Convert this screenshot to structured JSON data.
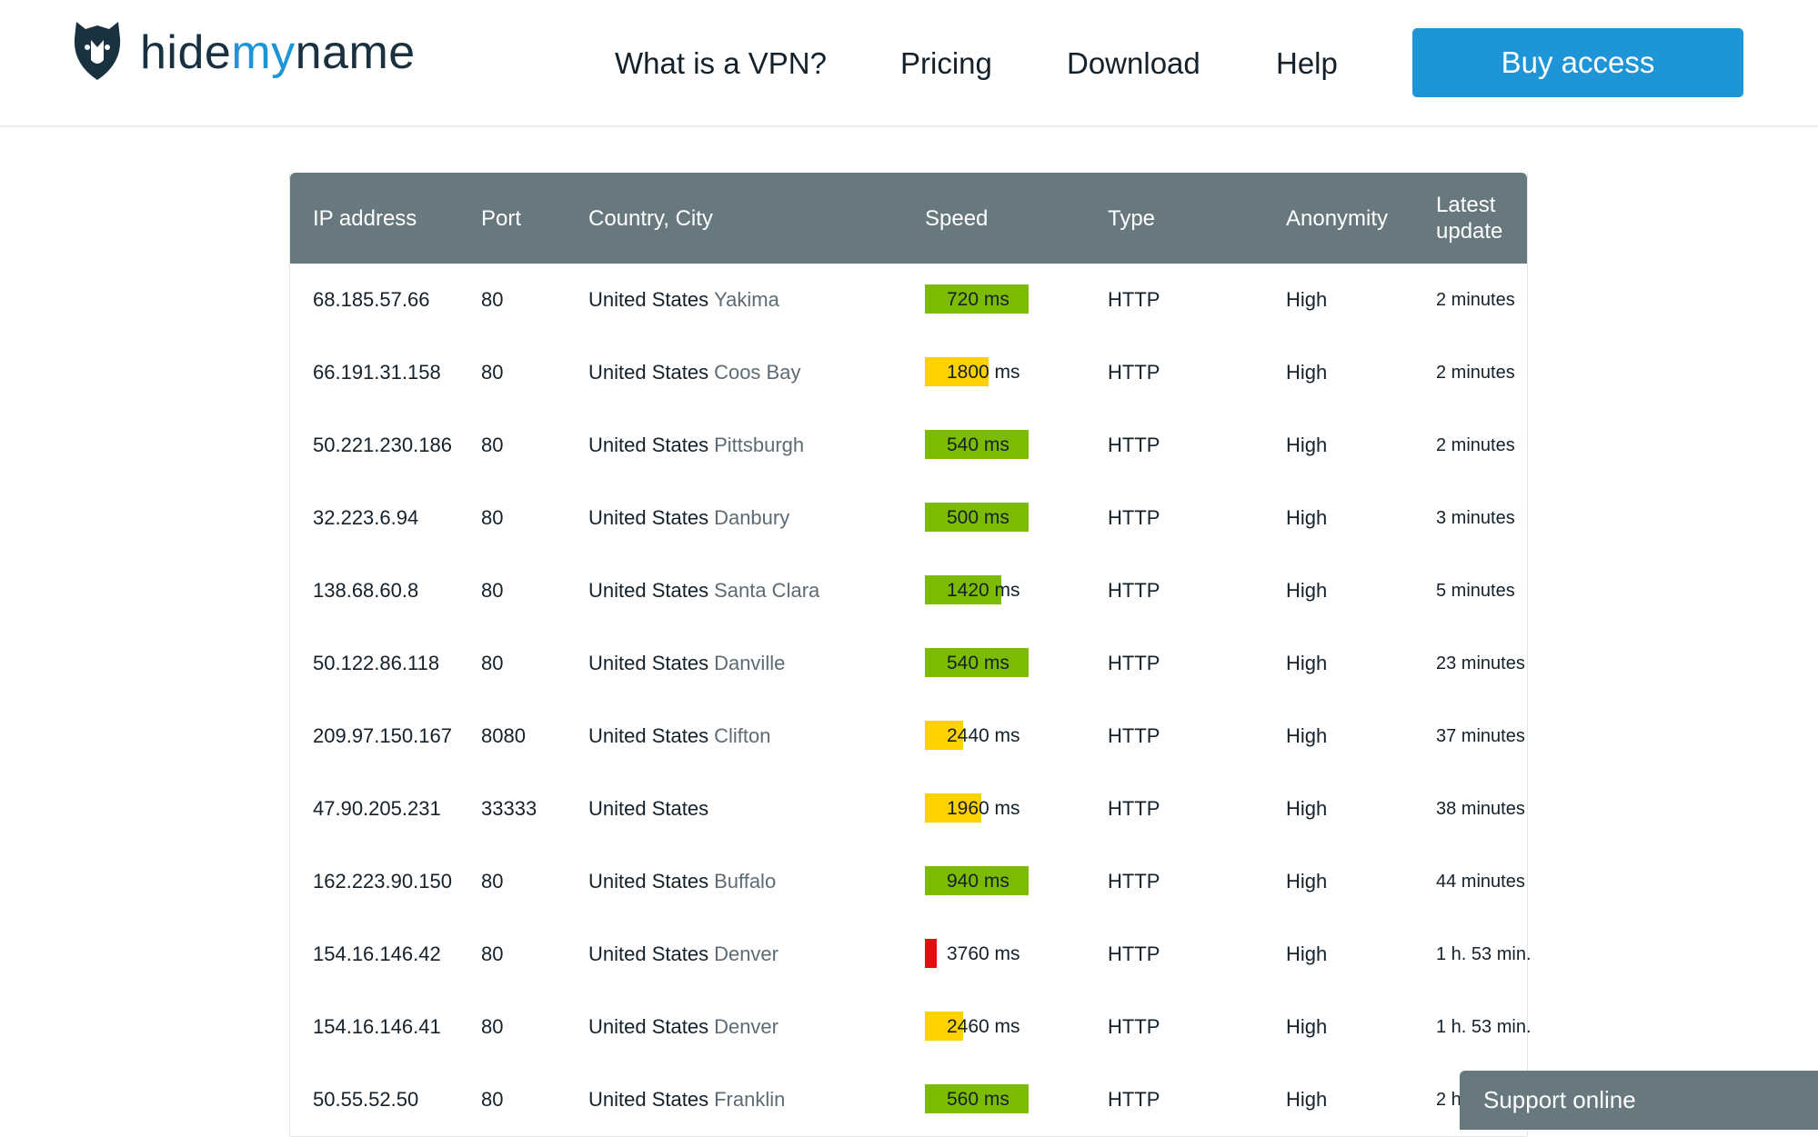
{
  "brand": {
    "name_part1": "hide",
    "name_part2": "my",
    "name_part3": "name",
    "logo_icon": "shield-fox-icon"
  },
  "nav": {
    "items": [
      "What is a VPN?",
      "Pricing",
      "Download",
      "Help"
    ],
    "buy_label": "Buy access"
  },
  "colors": {
    "accent": "#1e95d6",
    "header_bg": "#68787f",
    "speed_fast": "#7cbb00",
    "speed_medium": "#ffd100",
    "speed_slow": "#e01010"
  },
  "table": {
    "headers": {
      "ip": "IP address",
      "port": "Port",
      "country": "Country, City",
      "speed": "Speed",
      "type": "Type",
      "anonymity": "Anonymity",
      "update_line1": "Latest",
      "update_line2": "update"
    },
    "rows": [
      {
        "ip": "68.185.57.66",
        "port": "80",
        "country": "United States",
        "city": "Yakima",
        "speed": "720 ms",
        "speed_level": "fast",
        "type": "HTTP",
        "anonymity": "High",
        "update": "2 minutes"
      },
      {
        "ip": "66.191.31.158",
        "port": "80",
        "country": "United States",
        "city": "Coos Bay",
        "speed": "1800 ms",
        "speed_level": "medium",
        "type": "HTTP",
        "anonymity": "High",
        "update": "2 minutes"
      },
      {
        "ip": "50.221.230.186",
        "port": "80",
        "country": "United States",
        "city": "Pittsburgh",
        "speed": "540 ms",
        "speed_level": "fast",
        "type": "HTTP",
        "anonymity": "High",
        "update": "2 minutes"
      },
      {
        "ip": "32.223.6.94",
        "port": "80",
        "country": "United States",
        "city": "Danbury",
        "speed": "500 ms",
        "speed_level": "fast",
        "type": "HTTP",
        "anonymity": "High",
        "update": "3 minutes"
      },
      {
        "ip": "138.68.60.8",
        "port": "80",
        "country": "United States",
        "city": "Santa Clara",
        "speed": "1420 ms",
        "speed_level": "fast",
        "type": "HTTP",
        "anonymity": "High",
        "update": "5 minutes"
      },
      {
        "ip": "50.122.86.118",
        "port": "80",
        "country": "United States",
        "city": "Danville",
        "speed": "540 ms",
        "speed_level": "fast",
        "type": "HTTP",
        "anonymity": "High",
        "update": "23 minutes"
      },
      {
        "ip": "209.97.150.167",
        "port": "8080",
        "country": "United States",
        "city": "Clifton",
        "speed": "2440 ms",
        "speed_level": "medium",
        "type": "HTTP",
        "anonymity": "High",
        "update": "37 minutes"
      },
      {
        "ip": "47.90.205.231",
        "port": "33333",
        "country": "United States",
        "city": "",
        "speed": "1960 ms",
        "speed_level": "medium",
        "type": "HTTP",
        "anonymity": "High",
        "update": "38 minutes"
      },
      {
        "ip": "162.223.90.150",
        "port": "80",
        "country": "United States",
        "city": "Buffalo",
        "speed": "940 ms",
        "speed_level": "fast",
        "type": "HTTP",
        "anonymity": "High",
        "update": "44 minutes"
      },
      {
        "ip": "154.16.146.42",
        "port": "80",
        "country": "United States",
        "city": "Denver",
        "speed": "3760 ms",
        "speed_level": "slow",
        "type": "HTTP",
        "anonymity": "High",
        "update": "1 h. 53 min."
      },
      {
        "ip": "154.16.146.41",
        "port": "80",
        "country": "United States",
        "city": "Denver",
        "speed": "2460 ms",
        "speed_level": "medium",
        "type": "HTTP",
        "anonymity": "High",
        "update": "1 h. 53 min."
      },
      {
        "ip": "50.55.52.50",
        "port": "80",
        "country": "United States",
        "city": "Franklin",
        "speed": "560 ms",
        "speed_level": "fast",
        "type": "HTTP",
        "anonymity": "High",
        "update": "2 h"
      }
    ]
  },
  "support": {
    "label": "Support online"
  }
}
